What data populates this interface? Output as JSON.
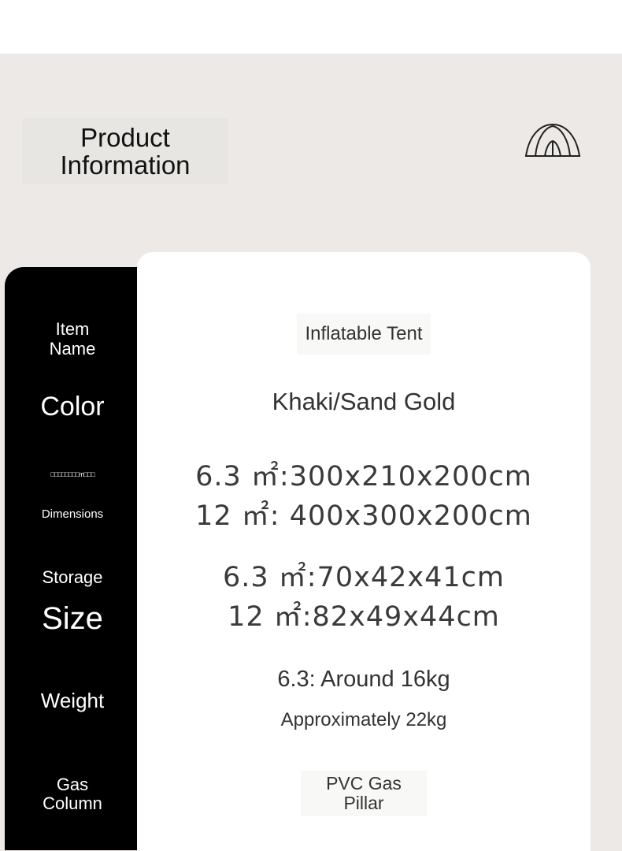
{
  "heading": "Product\nInformation",
  "rows": {
    "item_name": {
      "label": "Item\nName",
      "value": "Inflatable Tent"
    },
    "color": {
      "label": "Color",
      "value": "Khaki/Sand Gold"
    },
    "dimensions": {
      "label_top": "□□□□□□□□m□□□",
      "label": "Dimensions",
      "line1": "6.3 ㎡:300x210x200cm",
      "line2": "12 ㎡: 400x300x200cm"
    },
    "storage": {
      "label_top": "Storage",
      "label_bottom": "Size",
      "line1": "6.3 ㎡:70x42x41cm",
      "line2": "12 ㎡:82x49x44cm"
    },
    "weight": {
      "label": "Weight",
      "line1": "6.3: Around 16kg",
      "line2": "Approximately 22kg"
    },
    "gas_column": {
      "label": "Gas\nColumn",
      "value": "PVC Gas\nPillar"
    }
  },
  "colors": {
    "background": "#ede9e6",
    "label_column": "#000000",
    "card": "#ffffff"
  },
  "icons": {
    "tent": "tent-icon"
  }
}
